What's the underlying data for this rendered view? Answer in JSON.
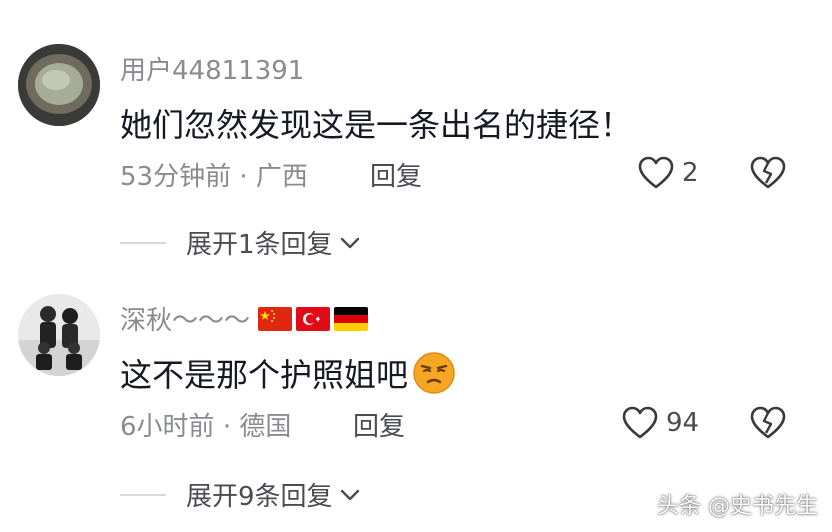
{
  "comments": [
    {
      "username": "用户44811391",
      "text": "她们忽然发现这是一条出名的捷径！",
      "time": "53分钟前",
      "separator": "·",
      "location": "广西",
      "reply_label": "回复",
      "likes": "2",
      "expand_label": "展开1条回复"
    },
    {
      "username": "深秋～～～",
      "flags": [
        "china-flag",
        "turkey-flag",
        "germany-flag"
      ],
      "text": "这不是那个护照姐吧",
      "emoji": "smirk-emoji",
      "time": "6小时前",
      "separator": "·",
      "location": "德国",
      "reply_label": "回复",
      "likes": "94",
      "expand_label": "展开9条回复"
    }
  ],
  "watermark": "头条 @史书先生",
  "colors": {
    "text_primary": "#161823",
    "text_secondary": "#8a8b91",
    "text_action": "#4b4c52"
  }
}
